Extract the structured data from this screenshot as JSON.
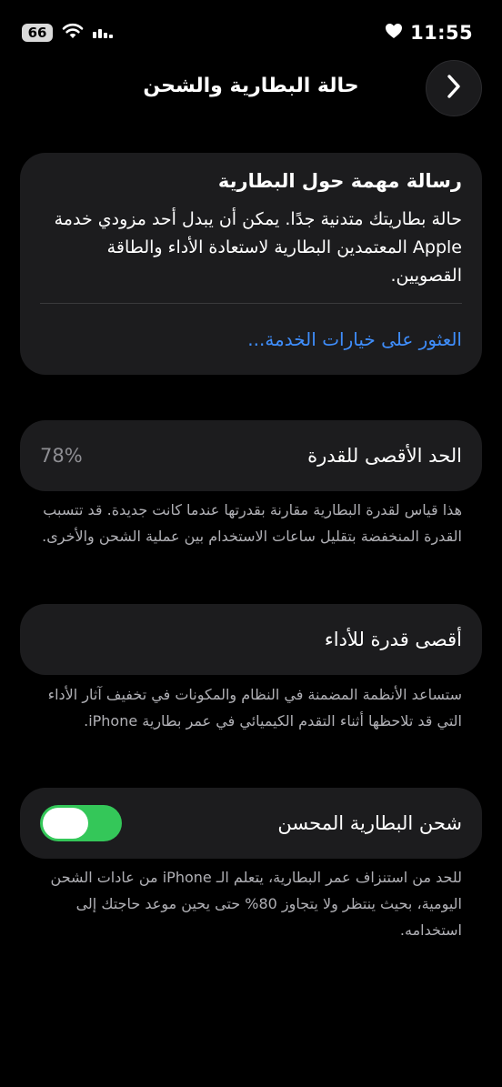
{
  "status_bar": {
    "battery_level": "66",
    "time": "11:55",
    "icons": [
      "wifi-icon",
      "signal-icon",
      "heart-icon"
    ]
  },
  "nav": {
    "title": "حالة البطارية والشحن",
    "back_icon": "chevron-right-icon"
  },
  "message": {
    "title": "رسالة مهمة حول البطارية",
    "body": "حالة بطاريتك متدنية جدًا. يمكن أن يبدل أحد مزودي خدمة Apple المعتمدين البطارية لاستعادة الأداء والطاقة القصويين.",
    "link": "العثور على خيارات الخدمة..."
  },
  "max_capacity": {
    "label": "الحد الأقصى للقدرة",
    "value": "78%",
    "footnote": "هذا قياس لقدرة البطارية مقارنة بقدرتها عندما كانت جديدة. قد تتسبب القدرة المنخفضة بتقليل ساعات الاستخدام بين عملية الشحن والأخرى."
  },
  "peak_performance": {
    "label": "أقصى قدرة للأداء",
    "footnote": "ستساعد الأنظمة المضمنة في النظام والمكونات في تخفيف آثار الأداء التي قد تلاحظها أثناء التقدم الكيميائي في عمر بطارية iPhone."
  },
  "optimized_charging": {
    "label": "شحن البطارية المحسن",
    "enabled": true,
    "footnote": "للحد من استنزاف عمر البطارية، يتعلم الـ iPhone من عادات الشحن اليومية، بحيث ينتظر ولا يتجاوز 80% حتى يحين موعد حاجتك إلى استخدامه."
  },
  "colors": {
    "background": "#000000",
    "card": "#1c1c1e",
    "link": "#3f8efc",
    "toggle_on": "#34c759",
    "secondary_text": "#8e8e93"
  }
}
